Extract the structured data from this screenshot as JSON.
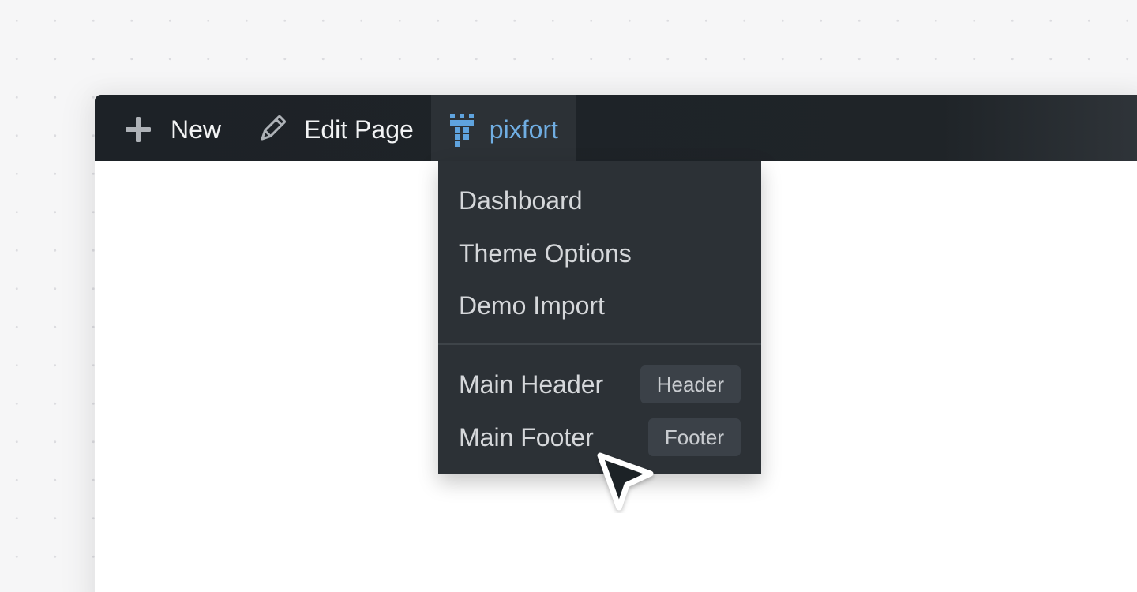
{
  "admin_bar": {
    "new_label": "New",
    "edit_label": "Edit Page",
    "brand_label": "pixfort",
    "icons": {
      "new": "plus-icon",
      "edit": "pencil-icon",
      "brand": "pixfort-castle-icon"
    }
  },
  "dropdown": {
    "items": [
      {
        "label": "Dashboard"
      },
      {
        "label": "Theme Options"
      },
      {
        "label": "Demo Import"
      }
    ],
    "builders": [
      {
        "label": "Main Header",
        "tag": "Header"
      },
      {
        "label": "Main Footer",
        "tag": "Footer"
      }
    ]
  },
  "colors": {
    "admin_bar_bg": "#1d2227",
    "dropdown_bg": "#2c3136",
    "brand_accent": "#70aee3",
    "tag_bg": "#3b4148"
  },
  "cursor": "mouse-pointer-icon"
}
